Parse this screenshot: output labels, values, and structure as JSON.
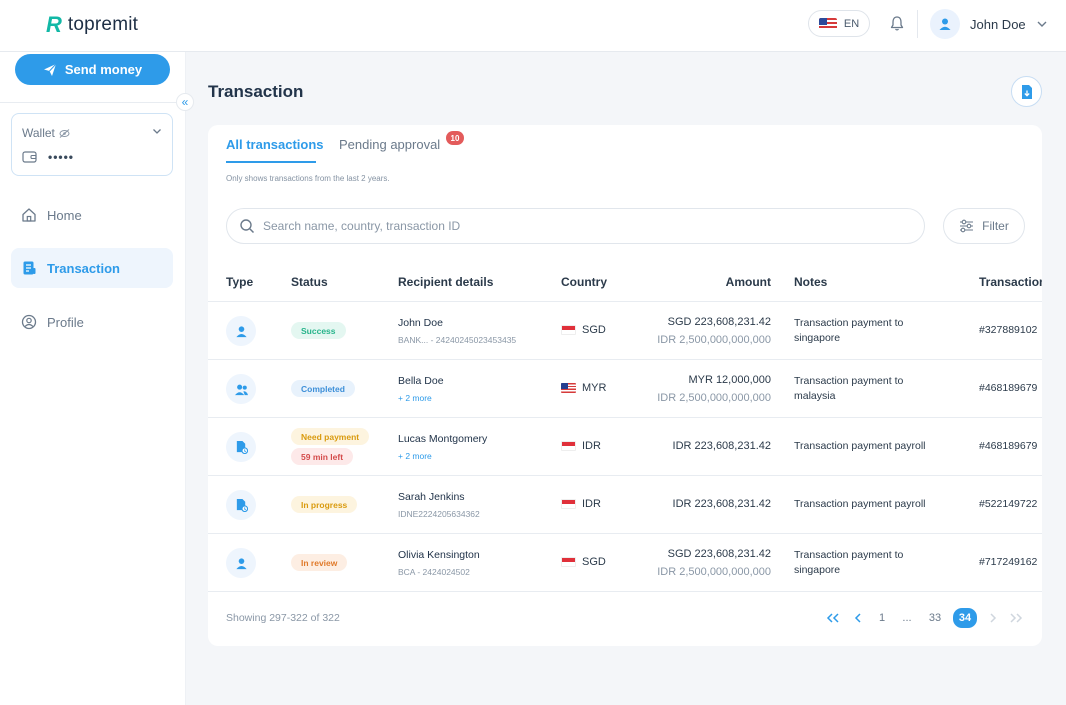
{
  "brand": {
    "logo_mark": "R",
    "name": "topremit"
  },
  "header": {
    "language": "EN",
    "user_name": "John Doe"
  },
  "sidebar": {
    "send_button": "Send money",
    "wallet_label": "Wallet",
    "wallet_value": "•••••",
    "items": [
      {
        "label": "Home",
        "active": false
      },
      {
        "label": "Transaction",
        "active": true
      },
      {
        "label": "Profile",
        "active": false
      }
    ]
  },
  "main": {
    "title": "Transaction",
    "tabs": [
      {
        "label": "All transactions"
      },
      {
        "label": "Pending approval",
        "badge": "10"
      }
    ],
    "hint": "Only shows transactions from the last 2 years.",
    "search": {
      "placeholder": "Search name, country, transaction ID"
    },
    "filter_label": "Filter",
    "columns": [
      "Type",
      "Status",
      "Recipient details",
      "Country",
      "Amount",
      "Notes",
      "Transaction"
    ],
    "rows": [
      {
        "type_icon": "user-icon",
        "status": "Success",
        "name": "John Doe",
        "sub": "BANK... - 24240245023453435",
        "currency": "SGD",
        "amount": "SGD 223,608,231.42",
        "amount_sub": "IDR 2,500,000,000,000",
        "note": "Transaction payment to singapore",
        "txid": "#327889102"
      },
      {
        "type_icon": "users-icon",
        "status": "Completed",
        "name": "Bella Doe",
        "more": "+ 2 more",
        "currency": "MYR",
        "amount": "MYR 12,000,000",
        "amount_sub": "IDR 2,500,000,000,000",
        "note": "Transaction payment to malaysia",
        "txid": "#468189679"
      },
      {
        "type_icon": "payroll-doc-icon",
        "status": "Need payment",
        "timer": "59 min left",
        "name": "Lucas Montgomery",
        "more": "+ 2 more",
        "currency": "IDR",
        "amount": "IDR 223,608,231.42",
        "note": "Transaction payment payroll",
        "txid": "#468189679"
      },
      {
        "type_icon": "payroll-doc-icon",
        "status": "In progress",
        "name": "Sarah Jenkins",
        "sub": "IDNE2224205634362",
        "currency": "IDR",
        "amount": "IDR 223,608,231.42",
        "note": "Transaction payment payroll",
        "txid": "#522149722"
      },
      {
        "type_icon": "user-icon",
        "status": "In review",
        "name": "Olivia Kensington",
        "sub": "BCA - 2424024502",
        "currency": "SGD",
        "amount": "SGD 223,608,231.42",
        "amount_sub": "IDR 2,500,000,000,000",
        "note": "Transaction payment to singapore",
        "txid": "#717249162"
      }
    ],
    "footer": "Showing 297-322 of 322",
    "pagination": {
      "pages": [
        "1",
        "...",
        "33",
        "34"
      ],
      "current": "34"
    }
  },
  "colors": {
    "accent": "#2e9be9",
    "brand": "#12b8a6",
    "success": "#27b48b",
    "warning": "#d99a0e",
    "danger": "#e35b5b"
  }
}
